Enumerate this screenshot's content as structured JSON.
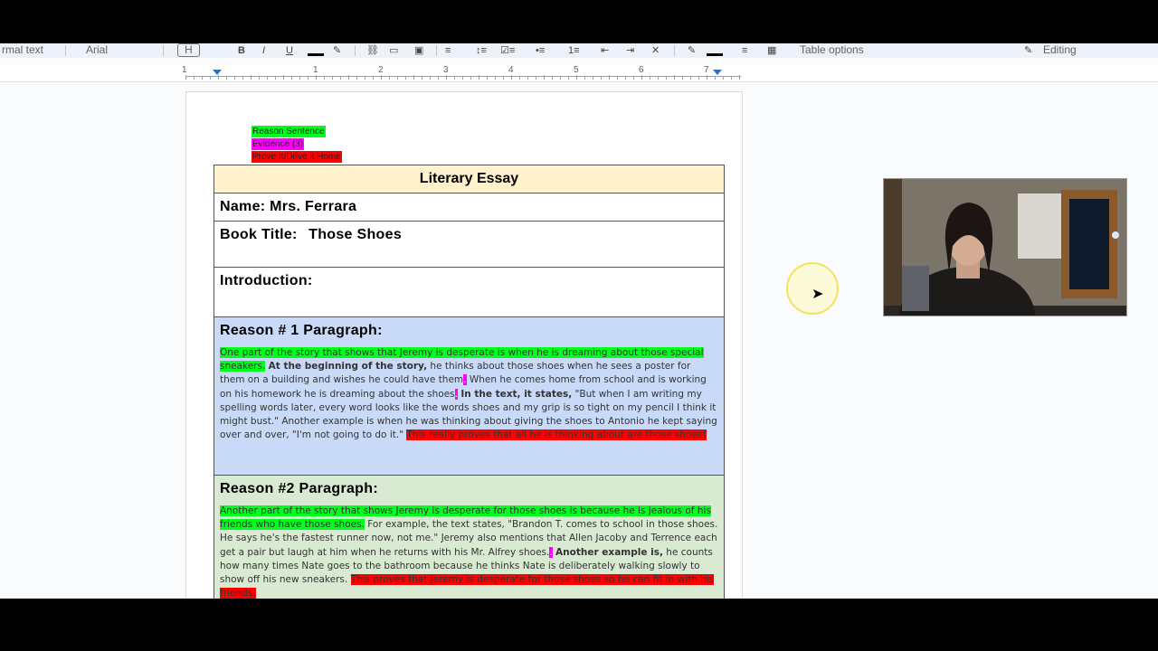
{
  "toolbar": {
    "style_label": "rmal text",
    "font_label": "Arial",
    "zoom_label": "H",
    "table_options_label": "Table options",
    "editing_label": "Editing"
  },
  "ruler": {
    "numbers": [
      "1",
      "1",
      "2",
      "3",
      "4",
      "5",
      "6",
      "7"
    ]
  },
  "legend": {
    "reason": "Reason Sentence",
    "evidence": "Evidence (3)",
    "prove": "Prove It/Drive it Home"
  },
  "essay": {
    "title": "Literary Essay",
    "name": "Name: Mrs. Ferrara",
    "book_title_label": "Book Title:",
    "book_title": "Those Shoes",
    "intro_label": "Introduction:",
    "reason1_label": "Reason # 1 Paragraph:",
    "reason1": {
      "reason": "One part of the story that shows that Jeremy is desperate is when he is dreaming about those special sneakers.",
      "lead1": "At the beginning of the story,",
      "ev1": " he thinks about those shoes when he sees a poster for them on a building and wishes he could have them",
      "ev2": " When he comes home from school and is working on his homework he is dreaming about the shoes",
      "lead2": "In the text, it states,",
      "ev3": " \"But when I am writing my spelling words later, every word looks like the words shoes and my grip is so tight on my pencil I think it might bust.\"",
      "ev4": " Another example is when he was thinking about giving the shoes to Antonio he kept saying over and over, \"I'm not going to do it.\"",
      "prove": "This really proves that all he is thinking about are those shoes!"
    },
    "reason2_label": "Reason #2 Paragraph:",
    "reason2": {
      "reason": "Another part of the story that shows Jeremy is desperate for those shoes is because he is jealous of his friends who have those shoes.",
      "ev1": " For example, the text states, \"Brandon T. comes to school in those shoes. He says he's the fastest runner now, not me.\"",
      "ev2": " Jeremy also mentions that Allen Jacoby and Terrence each get a pair but laugh at him when he returns with his Mr. Alfrey shoes.",
      "lead": "Another example is,",
      "ev3": " he counts how many times Nate goes to the bathroom because he thinks Nate is deliberately walking slowly to show off his new sneakers.",
      "prove": "This proves that Jeremy is desperate for those shoes so he can fit in with his friends."
    }
  }
}
